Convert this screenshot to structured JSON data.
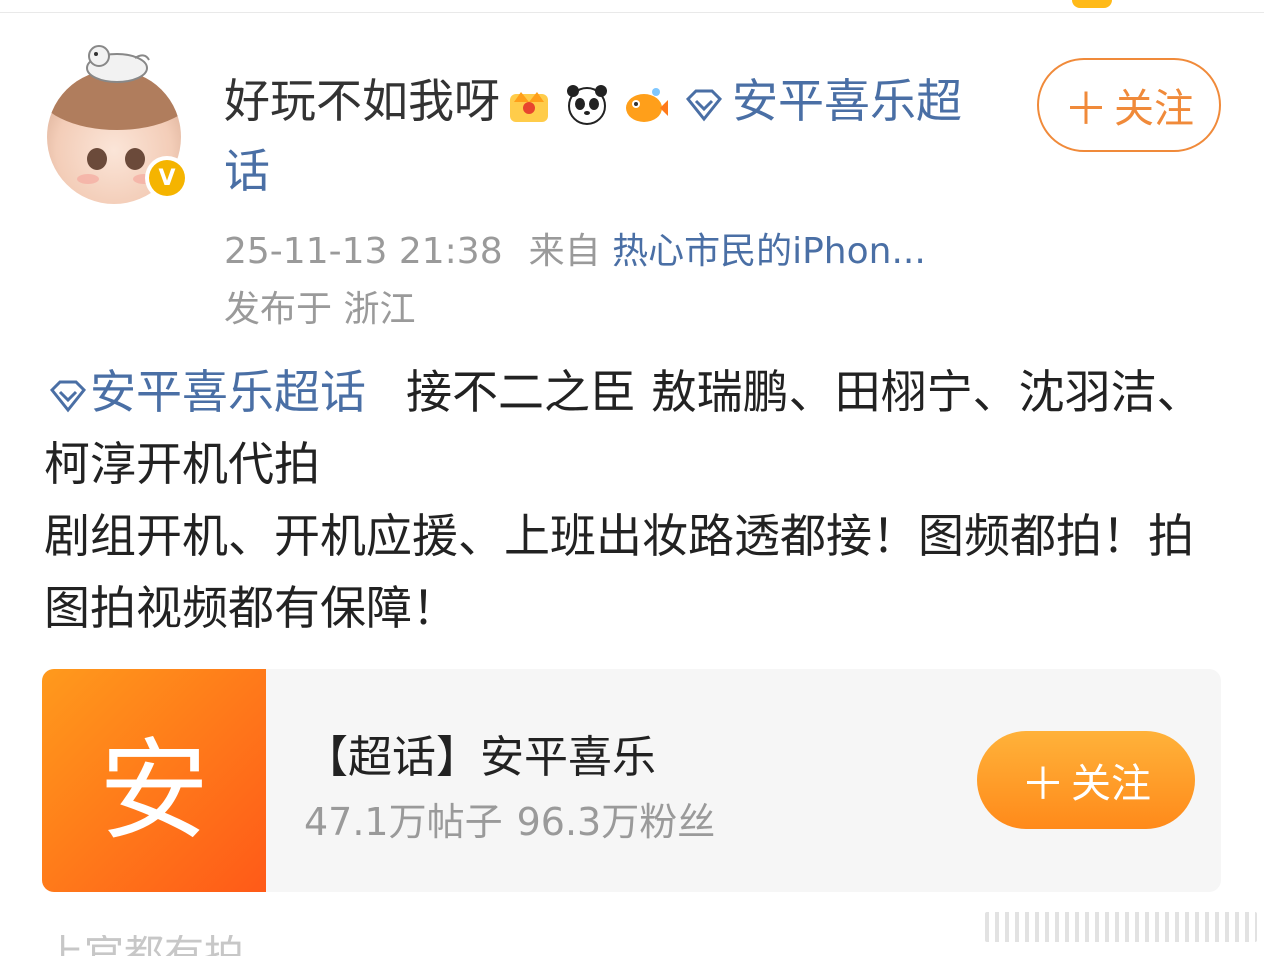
{
  "header": {
    "username": "好玩不如我呀",
    "badges": [
      "crown-badge-icon",
      "panda-badge-icon",
      "fish-badge-icon"
    ],
    "topic_tag": "安平喜乐超话",
    "topic_icon": "diamond-icon",
    "follow_label": "关注",
    "verified_icon": "verified-badge-icon"
  },
  "meta": {
    "timestamp": "25-11-13 21:38",
    "from_label": "来自",
    "source": "热心市民的iPhon...",
    "location": "发布于 浙江"
  },
  "post": {
    "topic_tag": "安平喜乐超话",
    "line1_text": "接不二之臣 敖瑞鹏、田栩宁、沈羽洁、柯淳开机代拍",
    "line2_text": "剧组开机、开机应援、上班出妆路透都接！图频都拍！拍图拍视频都有保障！"
  },
  "card": {
    "thumb_char": "安",
    "title": "【超话】安平喜乐",
    "posts": "47.1万帖子",
    "fans": "96.3万粉丝",
    "follow_label": "关注"
  },
  "footer": {
    "cut_text": "上官都有拍"
  },
  "colors": {
    "link": "#4a6fa5",
    "accent": "#f08a3a",
    "card_thumb": "#ff7a1a",
    "verified": "#f5b400"
  }
}
